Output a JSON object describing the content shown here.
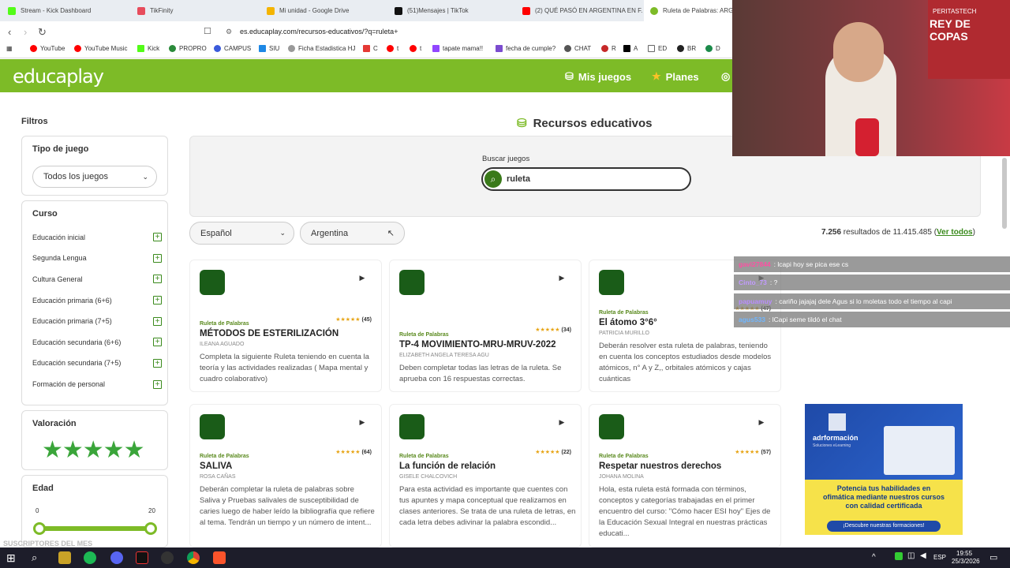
{
  "tabs": [
    {
      "label": "Stream - Kick Dashboard",
      "color": "#53fc18"
    },
    {
      "label": "TikFinity",
      "color": "#e74c5c"
    },
    {
      "label": "Mi unidad - Google Drive",
      "color": "#f4b400"
    },
    {
      "label": "(51)Mensajes | TikTok",
      "color": "#111111"
    },
    {
      "label": "(2) QUÉ PASÓ EN ARGENTINA EN F...",
      "color": "#ff0000"
    },
    {
      "label": "Ruleta de Palabras: ARGE...",
      "color": "#7dbb27"
    }
  ],
  "address": {
    "url": "es.educaplay.com/recursos-educativos/?q=ruleta+"
  },
  "bookmarks": [
    "YouTube",
    "YouTube Music",
    "Kick",
    "PROPRO",
    "CAMPUS",
    "SIU",
    "Ficha Estadistica HJ",
    "C",
    "t",
    "t",
    "tapate mama!!",
    "fecha de cumple?",
    "CHAT",
    "R",
    "A",
    "ED",
    "BR",
    "D"
  ],
  "header": {
    "logo": "educaplay",
    "nav": [
      "Mis juegos",
      "Planes"
    ]
  },
  "sidebar": {
    "title": "Filtros",
    "tipo_label": "Tipo de juego",
    "tipo_value": "Todos los juegos",
    "curso_label": "Curso",
    "cursos": [
      "Educación inicial",
      "Segunda Lengua",
      "Cultura General",
      "Educación primaria (6+6)",
      "Educación primaria (7+5)",
      "Educación secundaria (6+6)",
      "Educación secundaria (7+5)",
      "Formación de personal"
    ],
    "valoracion_label": "Valoración",
    "stars": "★★★★★",
    "edad_label": "Edad",
    "edad_min": "0",
    "edad_max": "20"
  },
  "main": {
    "title": "Recursos educativos",
    "search_label": "Buscar juegos",
    "search_value": "ruleta",
    "lang": "Español",
    "country": "Argentina",
    "results_count": "7.256",
    "results_text": " resultados de 11.415.485 (",
    "results_link": "Ver todos",
    "results_close": ")"
  },
  "games": [
    {
      "type": "Ruleta de Palabras",
      "stars": "★★★★★",
      "count": "(45)",
      "title": "MÉTODOS DE ESTERILIZACIÓN",
      "author": "ILEANA AGUADO",
      "desc": "Completa la siguiente Ruleta teniendo en cuenta la teoría y las actividades realizadas ( Mapa mental y cuadro colaborativo)"
    },
    {
      "type": "Ruleta de Palabras",
      "stars": "★★★★★",
      "count": "(34)",
      "title": "TP-4 MOVIMIENTO-MRU-MRUV-2022",
      "author": "ELIZABETH ANGELA TERESA AGU",
      "desc": "Deben completar todas las letras de la ruleta. Se aprueba con 16 respuestas correctas."
    },
    {
      "type": "Ruleta de Palabras",
      "stars": "★★★★★",
      "count": "(47)",
      "title": "El átomo 3°6°",
      "author": "PATRICIA MURILLO",
      "desc": "Deberán resolver esta ruleta de palabras, teniendo en cuenta los conceptos estudiados desde modelos atómicos, n° A y Z,, orbitales atómicos y cajas cuánticas"
    },
    {
      "type": "Ruleta de Palabras",
      "stars": "★★★★★",
      "count": "(64)",
      "title": "SALIVA",
      "author": "ROSA CAÑAS",
      "desc": "Deberán completar la ruleta de palabras sobre Saliva y Pruebas salivales de susceptibilidad de caries luego de haber leído la bibliografía que refiere al tema. Tendrán un tiempo y un número de intent..."
    },
    {
      "type": "Ruleta de Palabras",
      "stars": "★★★★★",
      "count": "(22)",
      "title": "La función de relación",
      "author": "GISELE CHALCOVICH",
      "desc": "Para esta actividad es importante que cuentes con tus apuntes y mapa conceptual que realizamos en clases anteriores. Se trata de una ruleta de letras, en cada letra debes adivinar la palabra escondid..."
    },
    {
      "type": "Ruleta de Palabras",
      "stars": "★★★★★",
      "count": "(57)",
      "title": "Respetar nuestros derechos",
      "author": "JOHANA MOLINA",
      "desc": "Hola, esta ruleta está formada con términos, conceptos y categorías trabajadas en el primer encuentro del curso: \"Cómo hacer ESI hoy\" Ejes de la Educación Sexual Integral en nuestras prácticas educati..."
    }
  ],
  "chat": [
    {
      "user": "gavi27844",
      "msg": ": lcapi hoy se pica ese cs",
      "color": "#ff4fa3"
    },
    {
      "user": "Cinto_73",
      "msg": ": ?",
      "color": "#c29bff"
    },
    {
      "user": "papuamuy",
      "msg": ": cariño jajajaj dele Agus si lo moletas todo el tiempo al capi",
      "color": "#b98cff"
    },
    {
      "user": "agus533",
      "msg": ": lCapi seme tildó el chat",
      "color": "#6fb6ff"
    }
  ],
  "ad": {
    "brand": "adrformación",
    "tagline": "Soluciones eLearning",
    "headline": "Potencia tus habilidades en ofimática mediante nuestros cursos con calidad certificada",
    "cta": "¡Descubre nuestras formaciones!"
  },
  "webcam": {
    "banner": "REY DE COPAS",
    "brand": "PERITASTECH"
  },
  "overlay_text": "SUSCRIPTORES DEL MES",
  "taskbar": {
    "time": "19:55",
    "date": "25/3/2026",
    "lang": "ESP"
  }
}
